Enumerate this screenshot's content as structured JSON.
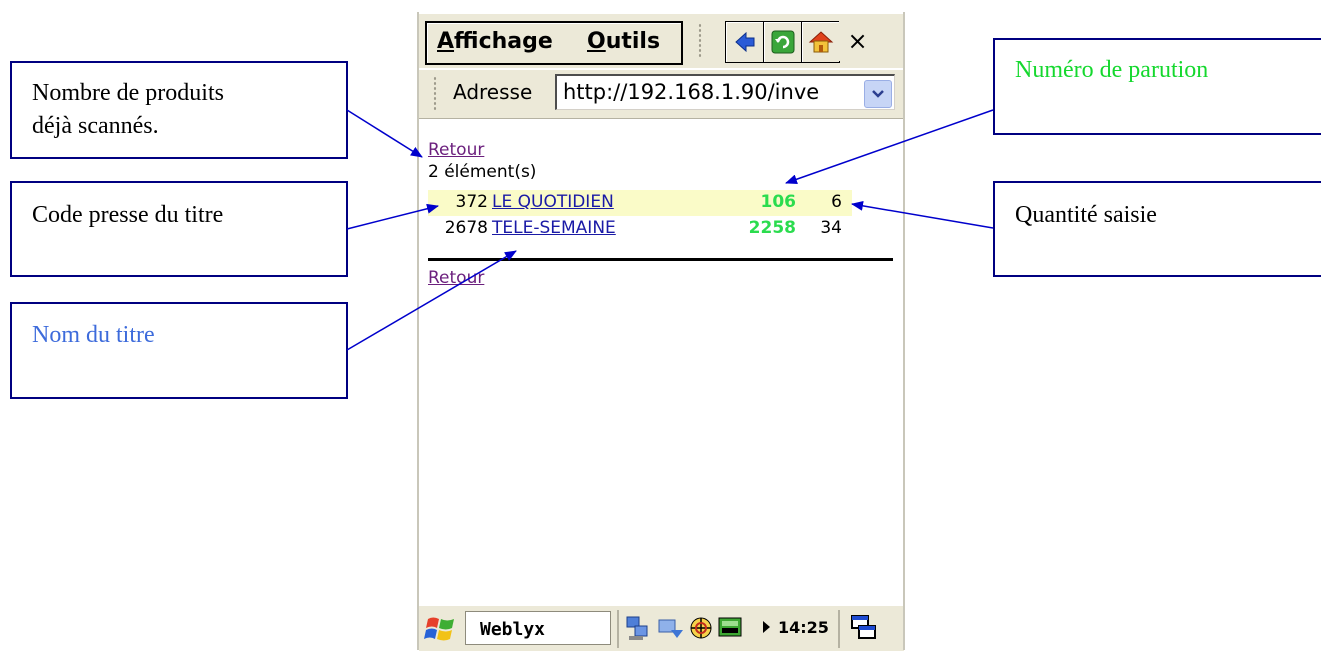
{
  "menubar": {
    "items": [
      {
        "underline": "A",
        "rest": "ffichage"
      },
      {
        "underline": "O",
        "rest": "utils"
      }
    ],
    "close_label": "×"
  },
  "address_bar": {
    "label": "Adresse",
    "value": "http://192.168.1.90/inve"
  },
  "page": {
    "retour_top": "Retour",
    "count_text": "2 élément(s)",
    "rows": [
      {
        "code": "372",
        "title": "LE QUOTIDIEN",
        "issue": "106",
        "qty": "6",
        "highlighted": true
      },
      {
        "code": "2678",
        "title": "TELE-SEMAINE",
        "issue": "2258",
        "qty": "34",
        "highlighted": false
      }
    ],
    "retour_bottom": "Retour"
  },
  "taskbar": {
    "app_label": "Weblyx",
    "clock": "14:25"
  },
  "callouts": {
    "scanned_count": [
      "Nombre de produits",
      "déjà scannés."
    ],
    "press_code": "Code presse du titre",
    "title_name": "Nom du titre",
    "issue_number": "Numéro de parution",
    "quantity": "Quantité saisie"
  },
  "colors": {
    "issue_green": "#2bdc4e",
    "callout_blue_text": "#3d6bdb",
    "callout_green_text": "#15d82e",
    "arrow_blue": "#0000cc",
    "row_highlight": "#fafbc8"
  }
}
